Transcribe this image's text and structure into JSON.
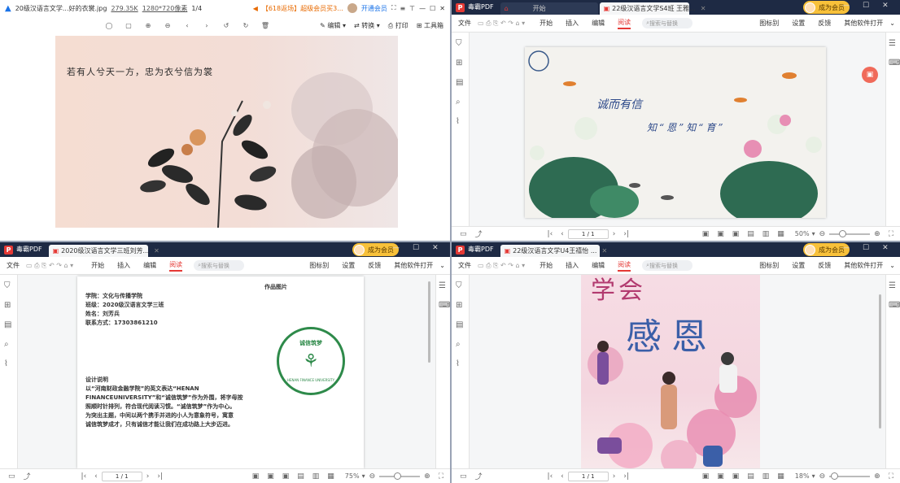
{
  "image_viewer": {
    "filename": "20级汉语言文学...好的衣裳.jpg",
    "filesize": "279.35K",
    "dimensions": "1280*720像素",
    "page": "1/4",
    "promo": "【618返场】超级会员买3...",
    "vip_link": "开通会员",
    "toolbar": {
      "edit": "编辑",
      "convert": "转换",
      "print": "打印",
      "tools": "工具箱"
    },
    "poster_text": "若有人兮天一方，忠为衣兮信为裳"
  },
  "pdf_top_right": {
    "app": "毒霸PDF",
    "tabs": [
      "开始",
      "22级汉语言文学S4班 王雅..."
    ],
    "vip": "成为会员",
    "menu": [
      "文件",
      "开始",
      "插入",
      "编辑",
      "阅读",
      "搜索与替换",
      "图标别",
      "设置",
      "反馈",
      "其他软件打开"
    ],
    "page_indicator": "1 / 1",
    "zoom": "50%",
    "slide_title": "诚而有信",
    "slide_subtitle": "知“恩”知“育”"
  },
  "pdf_bottom_left": {
    "app": "毒霸PDF",
    "tab": "2020级汉语言文学三班刘芳...",
    "vip": "成为会员",
    "menu": [
      "文件",
      "开始",
      "插入",
      "编辑",
      "阅读",
      "搜索与替换",
      "图标别",
      "设置",
      "反馈",
      "其他软件打开"
    ],
    "page_indicator": "1 / 1",
    "zoom": "75%",
    "doc": {
      "heading": "作品图片",
      "info": [
        "学院：文化与传播学院",
        "班级：2020级汉语言文学三班",
        "姓名：刘芳兵",
        "联系方式：17303861210"
      ],
      "design_title": "设计说明",
      "design_body": [
        "以“河南财政金融学院”的英文表达“HENAN",
        "FINANCEUNIVERSITY”和“诚信筑梦”作为外围，将字母按",
        "照顺时针排列，符合现代阅读习惯。“诚信筑梦”作为中心。",
        "为突出主题，中间以两个携手并进的小人为意象符号，寓意",
        "诚信筑梦成才，只有诚信才能让我们在成功路上大步迈进。"
      ],
      "logo_top": "诚信筑梦",
      "logo_ring": "HENAN FINANCE UNIVERSITY"
    }
  },
  "pdf_bottom_right": {
    "app": "毒霸PDF",
    "tab": "22级汉语言文学U4王禧怡 ...",
    "vip": "成为会员",
    "menu": [
      "文件",
      "开始",
      "插入",
      "编辑",
      "阅读",
      "搜索与替换",
      "图标别",
      "设置",
      "反馈",
      "其他软件打开"
    ],
    "page_indicator": "1 / 1",
    "zoom": "18%",
    "poster_line1": "学会",
    "poster_line2": "感恩"
  }
}
